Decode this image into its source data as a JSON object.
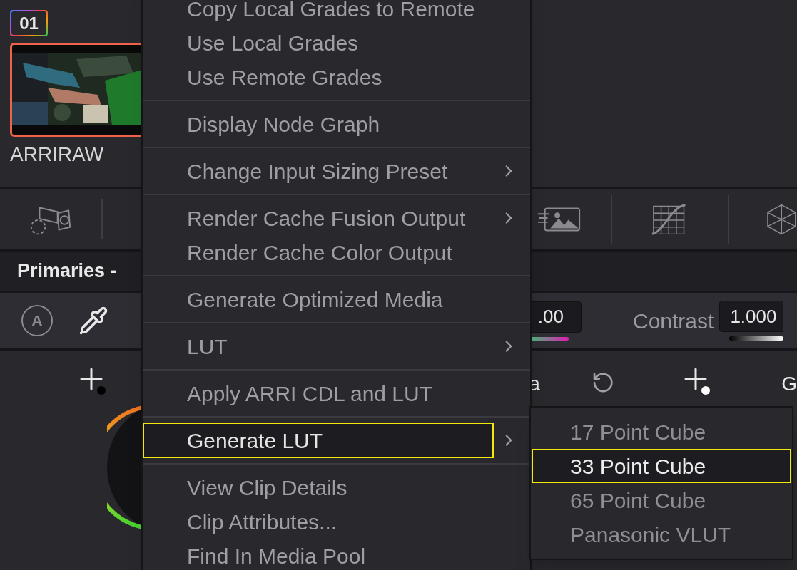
{
  "clip": {
    "number": "01",
    "label": "ARRIRAW",
    "selected": true
  },
  "palette": {
    "title": "Primaries -"
  },
  "controls": {
    "auto_button": "A",
    "field_1": ".00",
    "contrast_label": "Contrast",
    "contrast_value": "1.000"
  },
  "wheel_labels": [
    "a",
    "G"
  ],
  "context_menu": {
    "groups": [
      {
        "items": [
          {
            "label": "Copy Local Grades to Remote",
            "submenu": false,
            "selected": false
          },
          {
            "label": "Use Local Grades",
            "submenu": false,
            "selected": false
          },
          {
            "label": "Use Remote Grades",
            "submenu": false,
            "selected": false
          }
        ]
      },
      {
        "items": [
          {
            "label": "Display Node Graph",
            "submenu": false,
            "selected": false
          }
        ]
      },
      {
        "items": [
          {
            "label": "Change Input Sizing Preset",
            "submenu": true,
            "selected": false
          }
        ]
      },
      {
        "items": [
          {
            "label": "Render Cache Fusion Output",
            "submenu": true,
            "selected": false
          },
          {
            "label": "Render Cache Color Output",
            "submenu": false,
            "selected": false
          }
        ]
      },
      {
        "items": [
          {
            "label": "Generate Optimized Media",
            "submenu": false,
            "selected": false
          }
        ]
      },
      {
        "items": [
          {
            "label": "LUT",
            "submenu": true,
            "selected": false
          }
        ]
      },
      {
        "items": [
          {
            "label": "Apply ARRI CDL and LUT",
            "submenu": false,
            "selected": false
          }
        ]
      },
      {
        "items": [
          {
            "label": "Generate LUT",
            "submenu": true,
            "selected": true
          }
        ]
      },
      {
        "items": [
          {
            "label": "View Clip Details",
            "submenu": false,
            "selected": false
          },
          {
            "label": "Clip Attributes...",
            "submenu": false,
            "selected": false
          },
          {
            "label": "Find In Media Pool",
            "submenu": false,
            "selected": false
          }
        ]
      }
    ]
  },
  "submenu": {
    "items": [
      {
        "label": "17 Point Cube",
        "selected": false
      },
      {
        "label": "33 Point Cube",
        "selected": true
      },
      {
        "label": "65 Point Cube",
        "selected": false
      },
      {
        "label": "Panasonic VLUT",
        "selected": false
      }
    ]
  }
}
